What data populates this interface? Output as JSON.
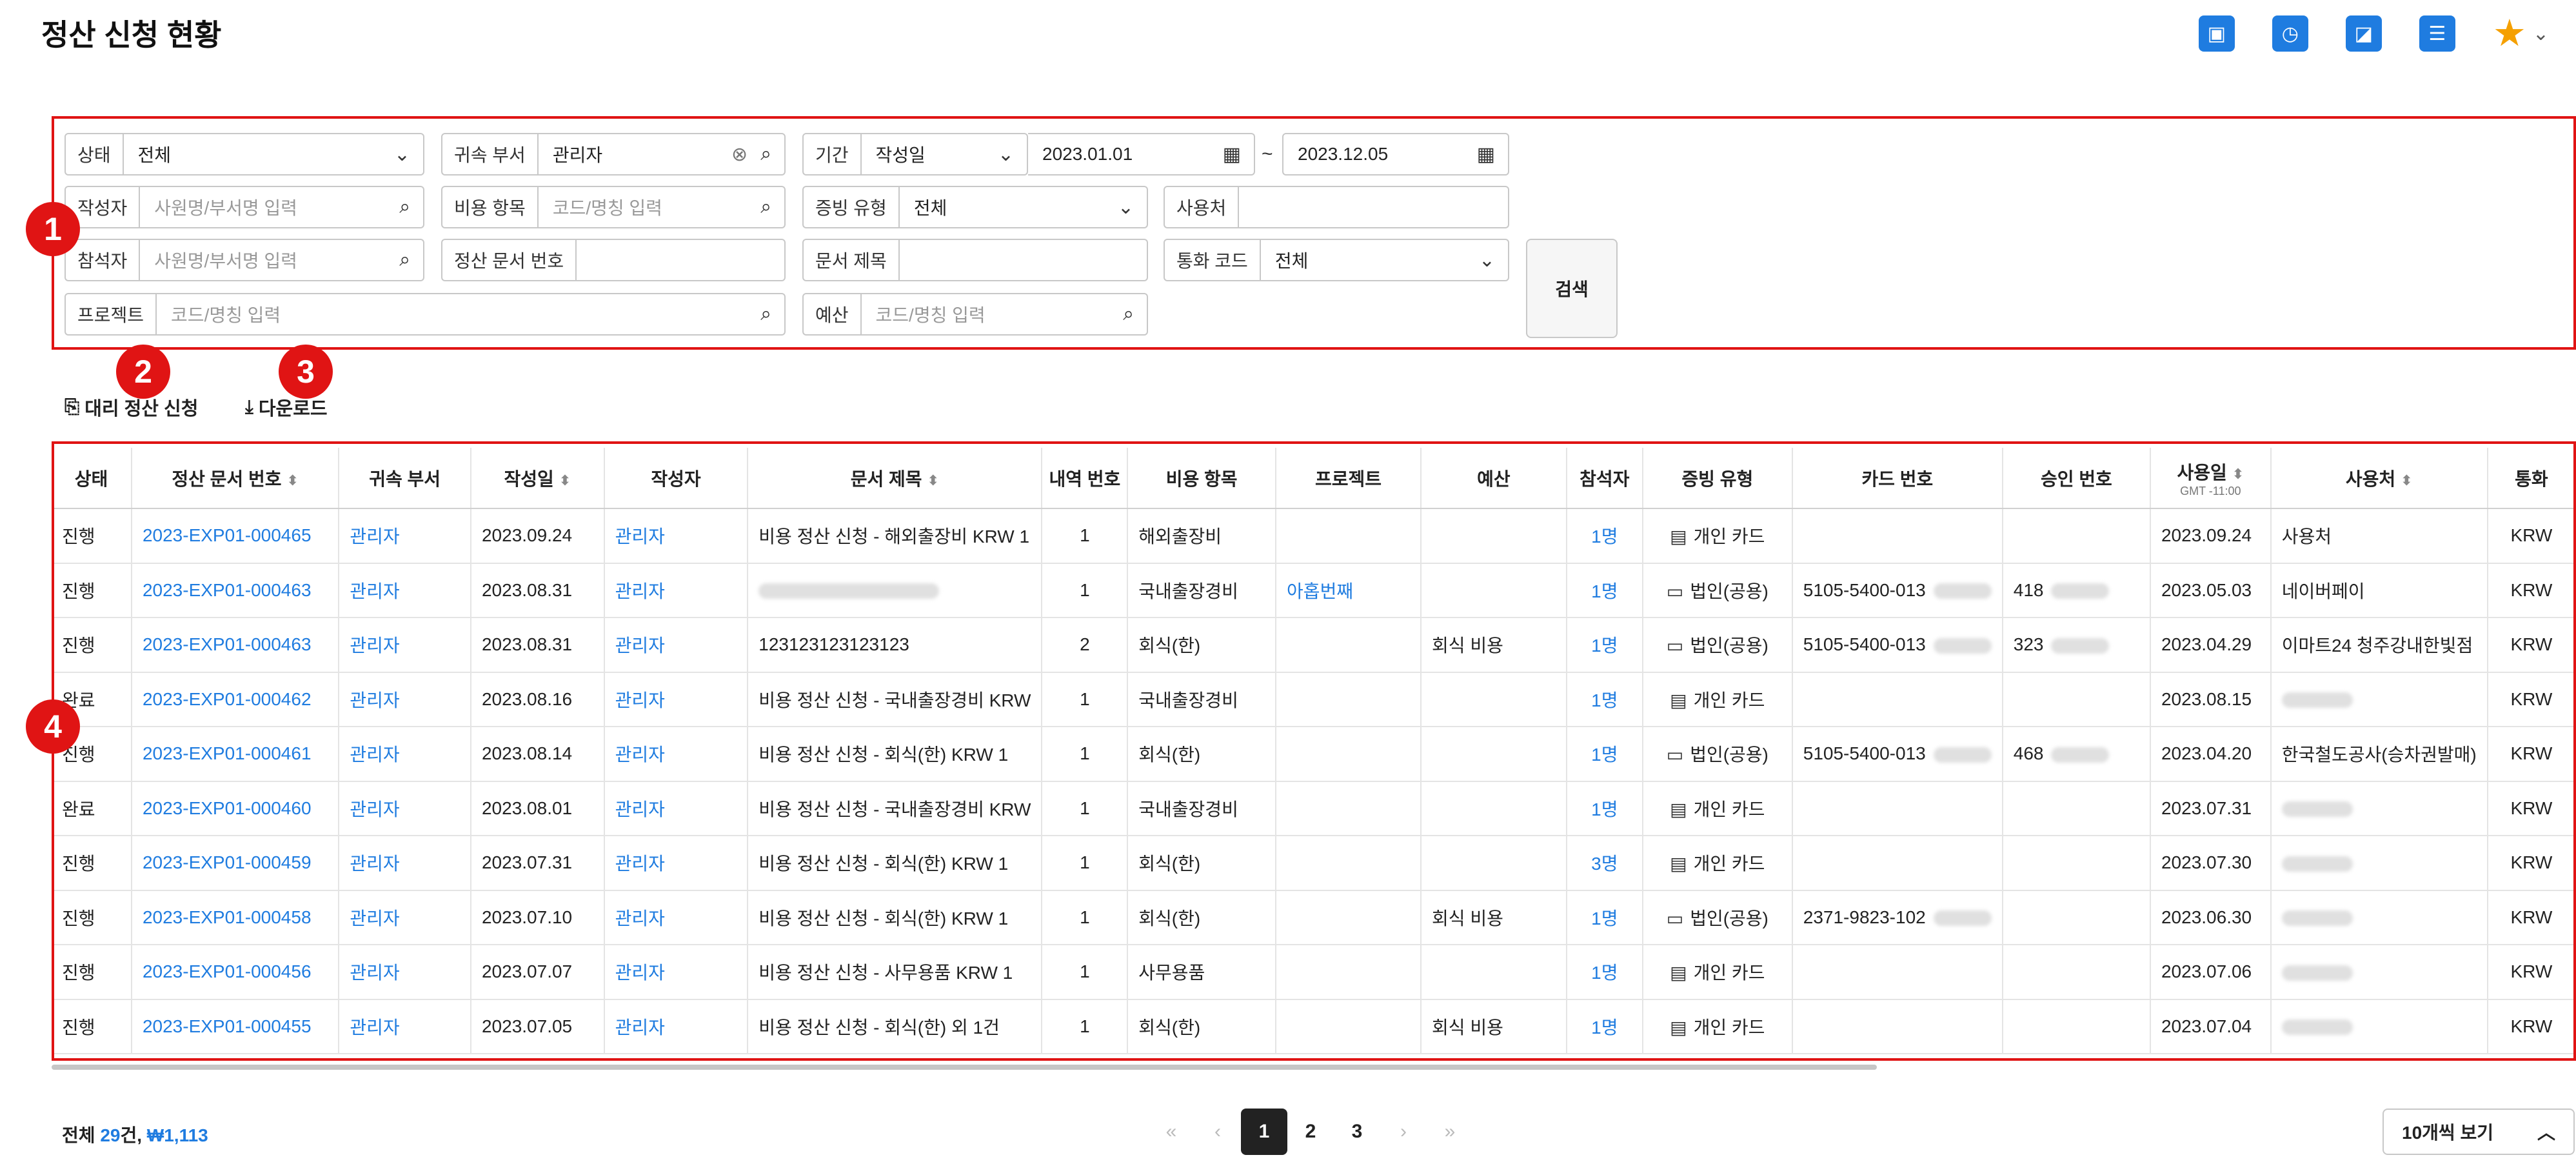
{
  "page": {
    "title": "정산 신청 현황"
  },
  "header_icons": [
    "id-badge-icon",
    "calendar-icon",
    "megaphone-icon",
    "document-list-icon",
    "star-icon"
  ],
  "badges": {
    "filter": "1",
    "proxy": "2",
    "download": "3",
    "table": "4"
  },
  "filters": {
    "status": {
      "label": "상태",
      "value": "전체"
    },
    "dept": {
      "label": "귀속 부서",
      "value": "관리자"
    },
    "period": {
      "label": "기간",
      "type": "작성일",
      "from": "2023.01.01",
      "sep": "~",
      "to": "2023.12.05"
    },
    "writer": {
      "label": "작성자",
      "placeholder": "사원명/부서명 입력"
    },
    "expense": {
      "label": "비용 항목",
      "placeholder": "코드/명칭 입력"
    },
    "evidence": {
      "label": "증빙 유형",
      "value": "전체"
    },
    "user_place": {
      "label": "사용처",
      "value": ""
    },
    "participant": {
      "label": "참석자",
      "placeholder": "사원명/부서명 입력"
    },
    "doc_no": {
      "label": "정산 문서 번호",
      "value": ""
    },
    "doc_title": {
      "label": "문서 제목",
      "value": ""
    },
    "currency": {
      "label": "통화 코드",
      "value": "전체"
    },
    "project": {
      "label": "프로젝트",
      "placeholder": "코드/명칭 입력"
    },
    "budget": {
      "label": "예산",
      "placeholder": "코드/명칭 입력"
    },
    "search_button": "검색"
  },
  "actions": {
    "proxy": "대리 정산 신청",
    "download": "다운로드"
  },
  "table": {
    "headers": [
      "상태",
      "정산 문서 번호",
      "귀속 부서",
      "작성일",
      "작성자",
      "문서 제목",
      "내역 번호",
      "비용 항목",
      "프로젝트",
      "예산",
      "참석자",
      "증빙 유형",
      "카드 번호",
      "승인 번호",
      "사용일",
      "사용처",
      "통화"
    ],
    "usedate_sub": "GMT -11:00",
    "rows": [
      [
        "진행",
        "2023-EXP01-000465",
        "관리자",
        "2023.09.24",
        "관리자",
        "비용 정산 신청 - 해외출장비 KRW 1",
        "1",
        "해외출장비",
        "",
        "",
        "1명",
        "개인 카드",
        "",
        "",
        "2023.09.24",
        "사용처",
        "KRW"
      ],
      [
        "진행",
        "2023-EXP01-000463",
        "관리자",
        "2023.08.31",
        "관리자",
        "",
        "1",
        "국내출장경비",
        "아홉번째",
        "",
        "1명",
        "법인(공용)",
        "5105-5400-013",
        "418",
        "2023.05.03",
        "네이버페이",
        "KRW"
      ],
      [
        "진행",
        "2023-EXP01-000463",
        "관리자",
        "2023.08.31",
        "관리자",
        "123123123123123",
        "2",
        "회식(한)",
        "",
        "회식 비용",
        "1명",
        "법인(공용)",
        "5105-5400-013",
        "323",
        "2023.04.29",
        "이마트24 청주강내한빛점",
        "KRW"
      ],
      [
        "완료",
        "2023-EXP01-000462",
        "관리자",
        "2023.08.16",
        "관리자",
        "비용 정산 신청 - 국내출장경비 KRW",
        "1",
        "국내출장경비",
        "",
        "",
        "1명",
        "개인 카드",
        "",
        "",
        "2023.08.15",
        "",
        "KRW"
      ],
      [
        "진행",
        "2023-EXP01-000461",
        "관리자",
        "2023.08.14",
        "관리자",
        "비용 정산 신청 - 회식(한) KRW 1",
        "1",
        "회식(한)",
        "",
        "",
        "1명",
        "법인(공용)",
        "5105-5400-013",
        "468",
        "2023.04.20",
        "한국철도공사(승차권발매)",
        "KRW"
      ],
      [
        "완료",
        "2023-EXP01-000460",
        "관리자",
        "2023.08.01",
        "관리자",
        "비용 정산 신청 - 국내출장경비 KRW",
        "1",
        "국내출장경비",
        "",
        "",
        "1명",
        "개인 카드",
        "",
        "",
        "2023.07.31",
        "",
        "KRW"
      ],
      [
        "진행",
        "2023-EXP01-000459",
        "관리자",
        "2023.07.31",
        "관리자",
        "비용 정산 신청 - 회식(한) KRW 1",
        "1",
        "회식(한)",
        "",
        "",
        "3명",
        "개인 카드",
        "",
        "",
        "2023.07.30",
        "",
        "KRW"
      ],
      [
        "진행",
        "2023-EXP01-000458",
        "관리자",
        "2023.07.10",
        "관리자",
        "비용 정산 신청 - 회식(한) KRW 1",
        "1",
        "회식(한)",
        "",
        "회식 비용",
        "1명",
        "법인(공용)",
        "2371-9823-102",
        "",
        "2023.06.30",
        "",
        "KRW"
      ],
      [
        "진행",
        "2023-EXP01-000456",
        "관리자",
        "2023.07.07",
        "관리자",
        "비용 정산 신청 - 사무용품 KRW 1",
        "1",
        "사무용품",
        "",
        "",
        "1명",
        "개인 카드",
        "",
        "",
        "2023.07.06",
        "",
        "KRW"
      ],
      [
        "진행",
        "2023-EXP01-000455",
        "관리자",
        "2023.07.05",
        "관리자",
        "비용 정산 신청 - 회식(한) 외 1건",
        "1",
        "회식(한)",
        "",
        "회식 비용",
        "1명",
        "개인 카드",
        "",
        "",
        "2023.07.04",
        "",
        "KRW"
      ]
    ]
  },
  "footer": {
    "total_prefix": "전체 ",
    "total_count": "29",
    "total_mid": "건, ",
    "total_amount": "₩1,113",
    "pages": [
      "1",
      "2",
      "3"
    ],
    "page_size": "10개씩 보기"
  }
}
